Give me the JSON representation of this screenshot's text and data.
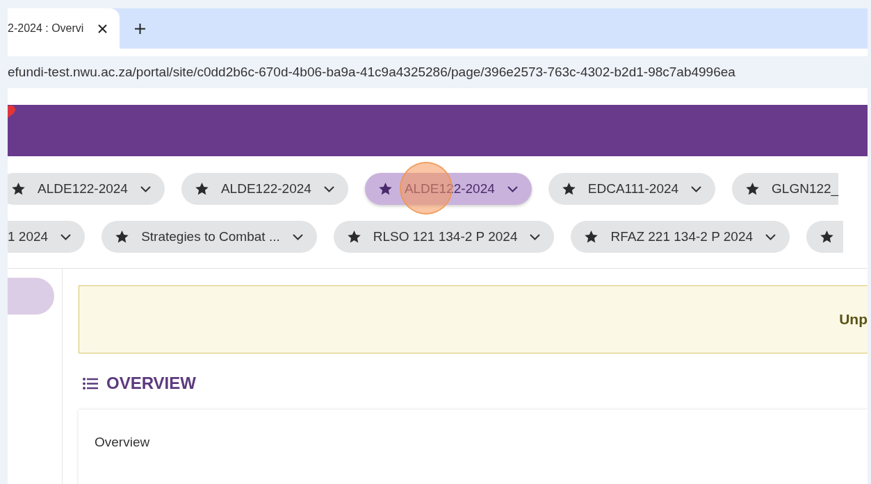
{
  "browser": {
    "tab": {
      "title": "2-2024 : Overvi"
    },
    "address": "efundi-test.nwu.ac.za/portal/site/c0dd2b6c-670d-4b06-ba9a-41c9a4325286/page/396e2573-763c-4302-b2d1-98c7ab4996ea"
  },
  "site_rows": [
    [
      {
        "label": "ALDE122-2024",
        "kind": "chip",
        "selected": false
      },
      {
        "label": "ALDE122-2024",
        "kind": "chip",
        "selected": false
      },
      {
        "label": "ALDE122-2024",
        "kind": "chip",
        "selected": true
      },
      {
        "label": "EDCA111-2024",
        "kind": "chip",
        "selected": false
      },
      {
        "label": "GLGN122_",
        "kind": "cut-right",
        "selected": false
      }
    ],
    [
      {
        "label": "1 2024",
        "kind": "cut-left",
        "selected": false
      },
      {
        "label": "Strategies to Combat ...",
        "kind": "chip",
        "selected": false
      },
      {
        "label": "RLSO 121 134-2 P 2024",
        "kind": "chip",
        "selected": false
      },
      {
        "label": "RFAZ 221 134-2 P 2024",
        "kind": "chip",
        "selected": false
      },
      {
        "kind": "icon-only",
        "selected": false
      }
    ]
  ],
  "notice": {
    "text": "Unp"
  },
  "section": {
    "heading": "OVERVIEW",
    "card_title": "Overview"
  }
}
